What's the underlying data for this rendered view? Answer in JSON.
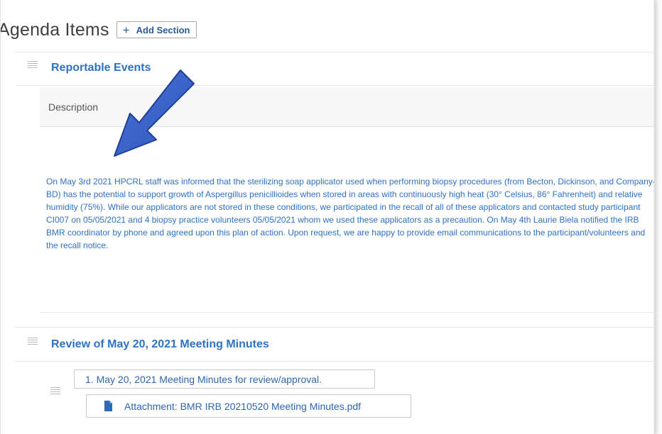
{
  "header": {
    "title": "Agenda Items",
    "add_section_label": "Add Section",
    "add_icon": "plus-icon"
  },
  "sections": [
    {
      "title": "Reportable Events",
      "description_label": "Description",
      "description": "On May 3rd 2021 HPCRL staff was informed that the sterilizing soap applicator used when performing biopsy procedures (from Becton, Dickinson, and Company-BD) has the potential to support growth of Aspergillus penicillioides when stored in areas with continuously high heat (30° Celsius, 86° Fahrenheit) and relative humidity (75%). While our applicators are not stored in these conditions, we participated in the recall of all of these applicators and contacted study participant CI007 on 05/05/2021 and 4 biopsy practice volunteers 05/05/2021 whom we used these applicators as a precaution. On May 4th Laurie Biela notified the IRB BMR coordinator by phone and agreed upon this plan of action. Upon request, we are happy to provide email communications to the participant/volunteers and the recall notice."
    },
    {
      "title": "Review of May 20, 2021 Meeting Minutes",
      "items": [
        {
          "label": "1. May 20, 2021 Meeting Minutes for review/approval.",
          "attachment": "Attachment: BMR IRB 20210520 Meeting Minutes.pdf",
          "attachment_icon": "file-icon"
        }
      ]
    }
  ],
  "annotation": {
    "arrow_icon": "arrow-annotation",
    "arrow_color": "#3a63c8"
  },
  "colors": {
    "link_blue": "#2e72c4",
    "text_blue": "#2f72c6"
  }
}
